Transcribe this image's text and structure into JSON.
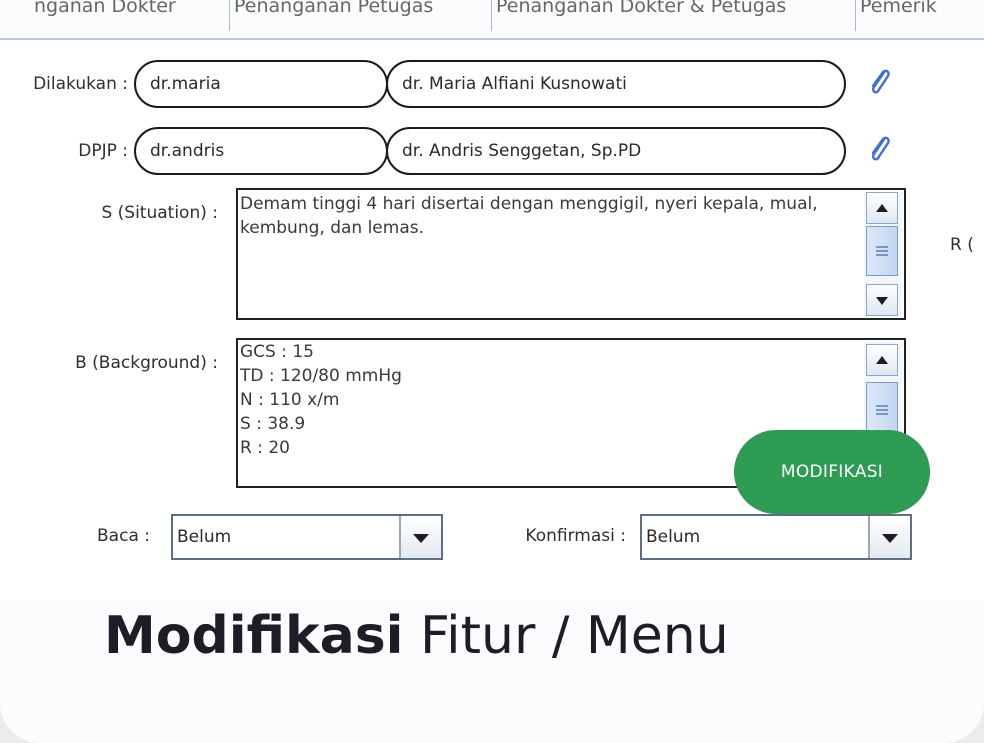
{
  "tabs": [
    "nganan Dokter",
    "Penanganan Petugas",
    "Penanganan Dokter & Petugas",
    "Pemerik"
  ],
  "form": {
    "dilakukan": {
      "label": "Dilakukan :",
      "code": "dr.maria",
      "name": "dr. Maria Alfiani Kusnowati"
    },
    "dpjp": {
      "label": "DPJP :",
      "code": "dr.andris",
      "name": "dr. Andris Senggetan, Sp.PD"
    },
    "situation": {
      "label": "S (Situation) :",
      "text": "Demam tinggi 4 hari disertai dengan menggigil, nyeri kepala, mual, kembung, dan lemas."
    },
    "background": {
      "label": "B (Background) :",
      "text": "GCS : 15\nTD : 120/80 mmHg\nN : 110 x/m\nS : 38.9\nR : 20"
    },
    "right_cut_label": "R (",
    "baca": {
      "label": "Baca :",
      "value": "Belum"
    },
    "konfirmasi": {
      "label": "Konfirmasi :",
      "value": "Belum"
    }
  },
  "badge": {
    "label": "MODIFIKASI",
    "color": "#2e9b53"
  },
  "caption": {
    "bold": "Modifikasi",
    "rest": " Fitur / Menu"
  },
  "icons": {
    "attach": "paperclip-icon",
    "scroll_up": "arrow-up-icon",
    "scroll_down": "arrow-down-icon",
    "dropdown": "caret-down-icon"
  }
}
